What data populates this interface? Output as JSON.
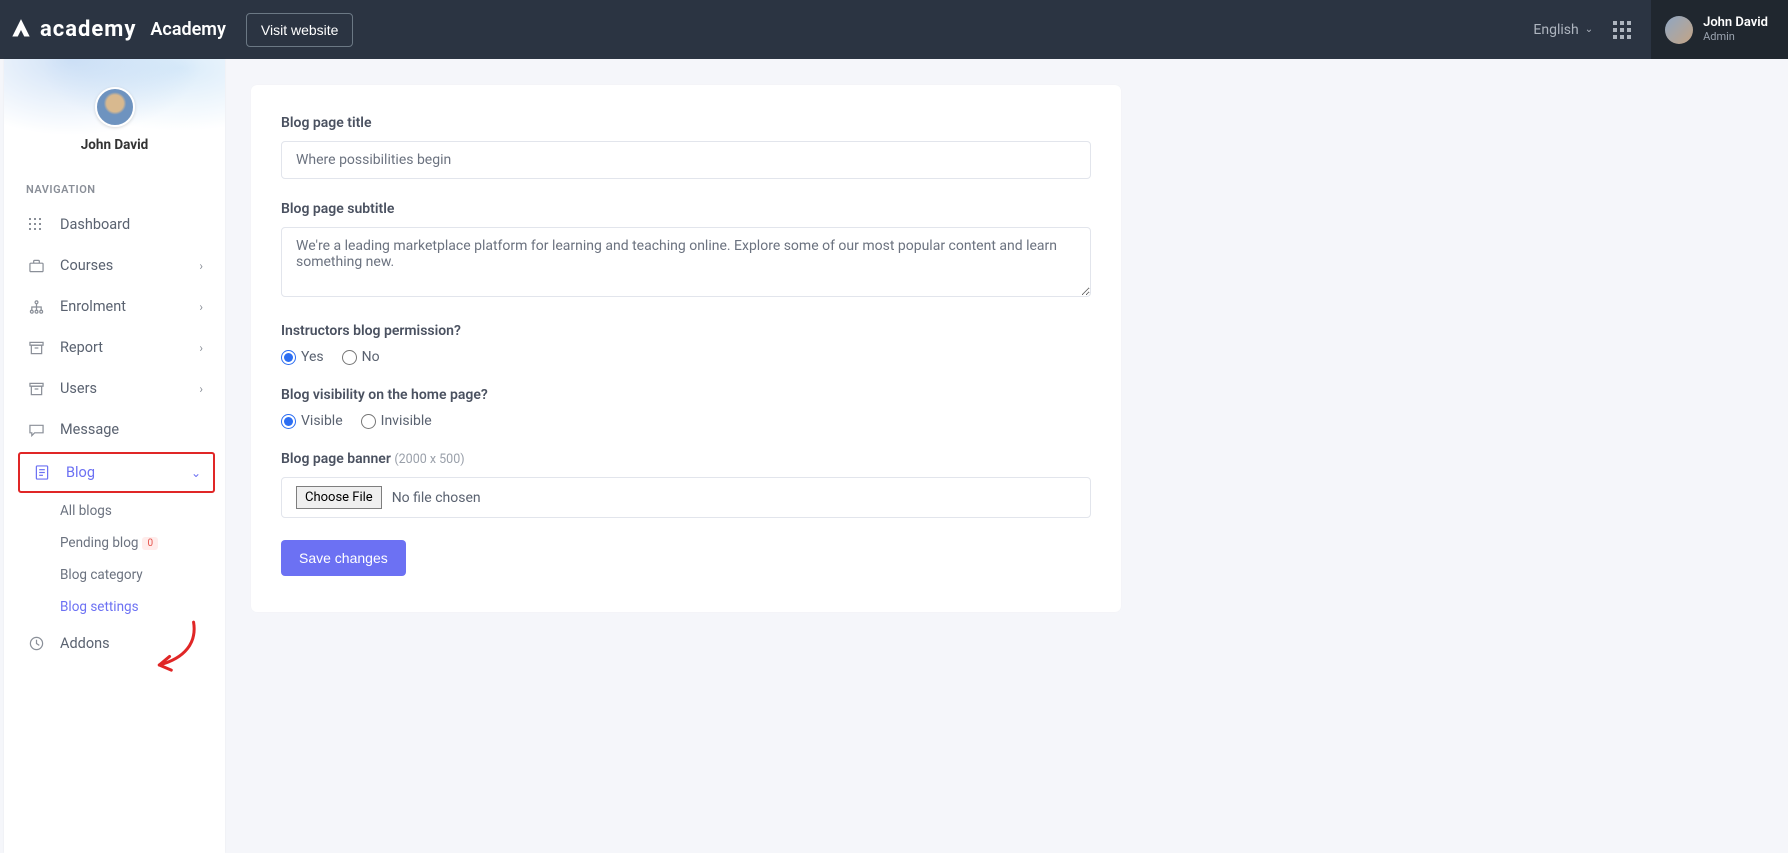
{
  "topbar": {
    "logo_text": "academy",
    "site_name": "Academy",
    "visit_button": "Visit website",
    "language": "English",
    "user_name": "John David",
    "user_role": "Admin"
  },
  "sidebar": {
    "profile_name": "John David",
    "nav_label": "NAVIGATION",
    "items": {
      "dashboard": "Dashboard",
      "courses": "Courses",
      "enrolment": "Enrolment",
      "report": "Report",
      "users": "Users",
      "message": "Message",
      "blog": "Blog",
      "addons": "Addons"
    },
    "blog_sub": {
      "all": "All blogs",
      "pending": "Pending blog",
      "pending_count": "0",
      "category": "Blog category",
      "settings": "Blog settings"
    }
  },
  "form": {
    "title_label": "Blog page title",
    "title_value": "Where possibilities begin",
    "subtitle_label": "Blog page subtitle",
    "subtitle_value": "We're a leading marketplace platform for learning and teaching online. Explore some of our most popular content and learn something new.",
    "permission_label": "Instructors blog permission?",
    "permission_yes": "Yes",
    "permission_no": "No",
    "visibility_label": "Blog visibility on the home page?",
    "visibility_visible": "Visible",
    "visibility_invisible": "Invisible",
    "banner_label": "Blog page banner",
    "banner_hint": "(2000 x 500)",
    "choose_file": "Choose File",
    "no_file": "No file chosen",
    "save": "Save changes"
  }
}
